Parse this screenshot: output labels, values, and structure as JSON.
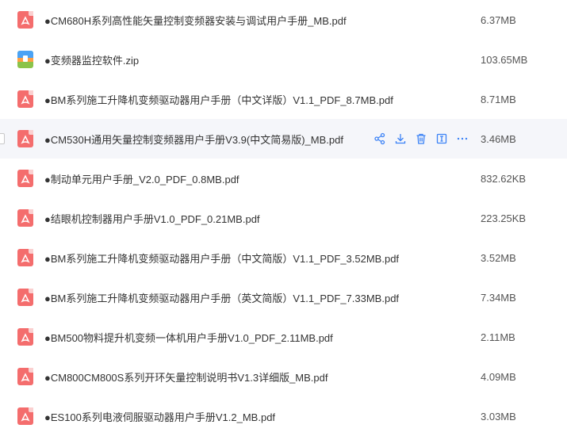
{
  "files": [
    {
      "name": "●CM680H系列高性能矢量控制变频器安装与调试用户手册_MB.pdf",
      "size": "6.37MB",
      "type": "pdf"
    },
    {
      "name": "●变频器监控软件.zip",
      "size": "103.65MB",
      "type": "zip"
    },
    {
      "name": "●BM系列施工升降机变频驱动器用户手册（中文详版）V1.1_PDF_8.7MB.pdf",
      "size": "8.71MB",
      "type": "pdf"
    },
    {
      "name": "●CM530H通用矢量控制变频器用户手册V3.9(中文简易版)_MB.pdf",
      "size": "3.46MB",
      "type": "pdf"
    },
    {
      "name": "●制动单元用户手册_V2.0_PDF_0.8MB.pdf",
      "size": "832.62KB",
      "type": "pdf"
    },
    {
      "name": "●结眼机控制器用户手册V1.0_PDF_0.21MB.pdf",
      "size": "223.25KB",
      "type": "pdf"
    },
    {
      "name": "●BM系列施工升降机变频驱动器用户手册（中文简版）V1.1_PDF_3.52MB.pdf",
      "size": "3.52MB",
      "type": "pdf"
    },
    {
      "name": "●BM系列施工升降机变频驱动器用户手册（英文简版）V1.1_PDF_7.33MB.pdf",
      "size": "7.34MB",
      "type": "pdf"
    },
    {
      "name": "●BM500物料提升机变频一体机用户手册V1.0_PDF_2.11MB.pdf",
      "size": "2.11MB",
      "type": "pdf"
    },
    {
      "name": "●CM800CM800S系列开环矢量控制说明书V1.3详细版_MB.pdf",
      "size": "4.09MB",
      "type": "pdf"
    },
    {
      "name": "●ES100系列电液伺服驱动器用户手册V1.2_MB.pdf",
      "size": "3.03MB",
      "type": "pdf"
    }
  ],
  "hover_actions": [
    "share-icon",
    "download-icon",
    "delete-icon",
    "rename-icon",
    "more-icon"
  ],
  "colors": {
    "pdf": "#f46d6d",
    "accent": "#3b82f6",
    "hover_bg": "#f5f6fa"
  }
}
